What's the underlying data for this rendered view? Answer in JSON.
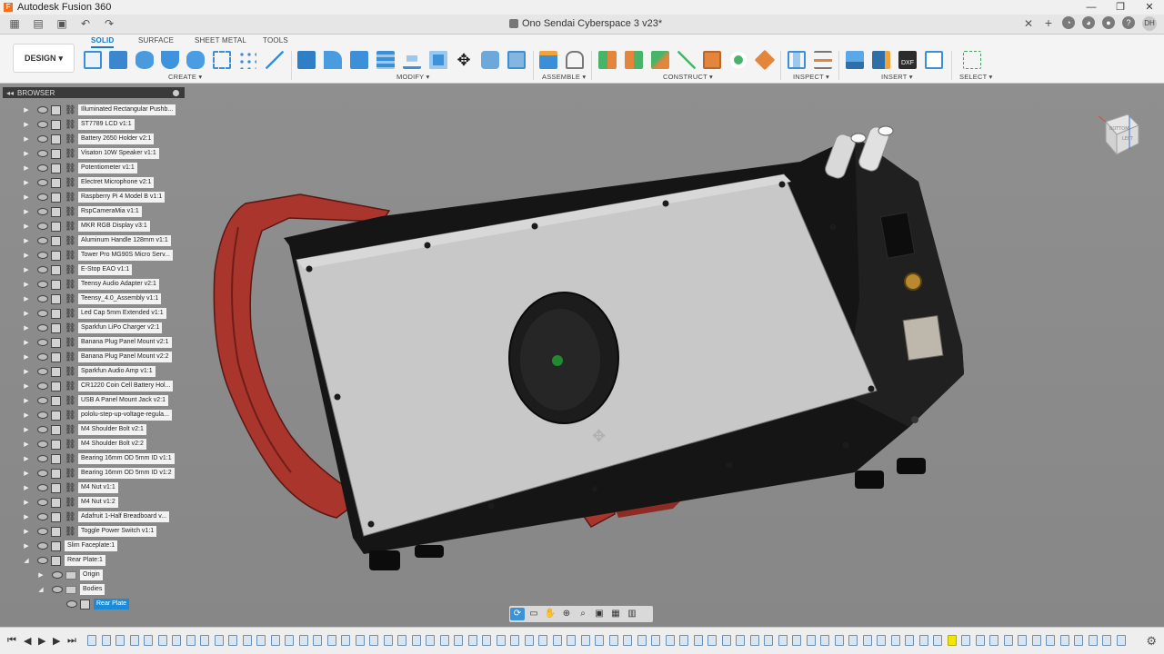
{
  "window": {
    "app_title": "Autodesk Fusion 360",
    "doc_title": "Ono Sendai Cyberspace 3 v23*",
    "controls": [
      "—",
      "❐",
      "✕"
    ]
  },
  "toolbar": {
    "workspace": "DESIGN",
    "tabs": [
      {
        "label": "SOLID",
        "active": true
      },
      {
        "label": "SURFACE",
        "active": false
      },
      {
        "label": "SHEET METAL",
        "active": false
      },
      {
        "label": "TOOLS",
        "active": false
      }
    ],
    "groups": [
      "CREATE ▾",
      "MODIFY ▾",
      "ASSEMBLE ▾",
      "CONSTRUCT ▾",
      "INSPECT ▾",
      "INSERT ▾",
      "SELECT ▾"
    ]
  },
  "browser": {
    "title": "BROWSER",
    "items": [
      {
        "label": "Illuminated Rectangular Pushb...",
        "depth": 0,
        "type": "component"
      },
      {
        "label": "ST7789 LCD v1:1",
        "depth": 0,
        "type": "component"
      },
      {
        "label": "Battery 2650 Holder v2:1",
        "depth": 0,
        "type": "component"
      },
      {
        "label": "Visaton 10W Speaker v1:1",
        "depth": 0,
        "type": "component"
      },
      {
        "label": "Potentiometer v1:1",
        "depth": 0,
        "type": "component"
      },
      {
        "label": "Electret Microphone v2:1",
        "depth": 0,
        "type": "component"
      },
      {
        "label": "Raspberry Pi 4 Model B v1:1",
        "depth": 0,
        "type": "component"
      },
      {
        "label": "RspCameraMia v1:1",
        "depth": 0,
        "type": "component"
      },
      {
        "label": "MKR RGB Display v3:1",
        "depth": 0,
        "type": "component"
      },
      {
        "label": "Aluminum Handle 128mm v1:1",
        "depth": 0,
        "type": "component"
      },
      {
        "label": "Tower Pro MG90S Micro Serv...",
        "depth": 0,
        "type": "component"
      },
      {
        "label": "E-Stop EAO v1:1",
        "depth": 0,
        "type": "component"
      },
      {
        "label": "Teensy Audio Adapter v2:1",
        "depth": 0,
        "type": "component"
      },
      {
        "label": "Teensy_4.0_Assembly v1:1",
        "depth": 0,
        "type": "component"
      },
      {
        "label": "Led Cap 5mm Extended v1:1",
        "depth": 0,
        "type": "component"
      },
      {
        "label": "Sparkfun LiPo Charger v2:1",
        "depth": 0,
        "type": "component"
      },
      {
        "label": "Banana Plug Panel Mount v2:1",
        "depth": 0,
        "type": "component"
      },
      {
        "label": "Banana Plug Panel Mount v2:2",
        "depth": 0,
        "type": "component"
      },
      {
        "label": "Sparkfun Audio Amp v1:1",
        "depth": 0,
        "type": "component"
      },
      {
        "label": "CR1220 Coin Cell Battery Hol...",
        "depth": 0,
        "type": "component"
      },
      {
        "label": "USB A Panel Mount Jack v2:1",
        "depth": 0,
        "type": "component"
      },
      {
        "label": "pololu-step-up-voltage-regula...",
        "depth": 0,
        "type": "component"
      },
      {
        "label": "M4 Shoulder Bolt v2:1",
        "depth": 0,
        "type": "component"
      },
      {
        "label": "M4 Shoulder Bolt v2:2",
        "depth": 0,
        "type": "component"
      },
      {
        "label": "Bearing 16mm OD 5mm ID v1:1",
        "depth": 0,
        "type": "component"
      },
      {
        "label": "Bearing 16mm OD 5mm ID v1:2",
        "depth": 0,
        "type": "component"
      },
      {
        "label": "M4 Nut v1:1",
        "depth": 0,
        "type": "component"
      },
      {
        "label": "M4 Nut v1:2",
        "depth": 0,
        "type": "component"
      },
      {
        "label": "Adafruit 1-Half Breadboard v...",
        "depth": 0,
        "type": "component"
      },
      {
        "label": "Toggle Power Switch v1:1",
        "depth": 0,
        "type": "component"
      },
      {
        "label": "Slim Faceplate:1",
        "depth": 0,
        "type": "local"
      },
      {
        "label": "Rear Plate:1",
        "depth": 0,
        "type": "local-open"
      },
      {
        "label": "Origin",
        "depth": 1,
        "type": "folder"
      },
      {
        "label": "Bodies",
        "depth": 1,
        "type": "folder-open"
      },
      {
        "label": "Rear Plate",
        "depth": 2,
        "type": "body",
        "selected": true
      }
    ]
  },
  "viewcube": {
    "faces": [
      "BOTTOM",
      "LEFT"
    ]
  },
  "navbar": {
    "icons": [
      "orbit-icon",
      "look-at-icon",
      "pan-icon",
      "zoom-icon",
      "fit-icon",
      "display-settings-icon",
      "grid-icon",
      "viewports-icon"
    ]
  },
  "timeline": {
    "step_count": 74,
    "marker_index": 61
  },
  "colors": {
    "accent": "#1a78c2",
    "selection": "#1a8bd8",
    "handle_red": "#a9352c",
    "case_black": "#151515",
    "plate_grey": "#c5c5c5"
  }
}
